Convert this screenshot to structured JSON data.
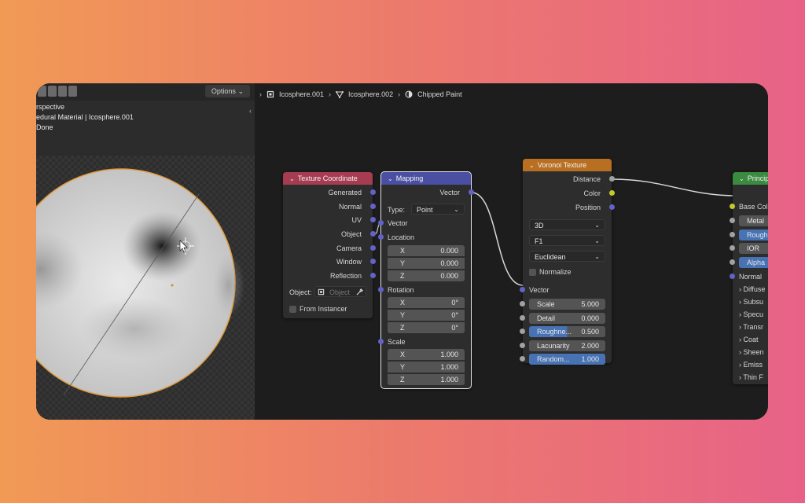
{
  "colors": {
    "texture_coordinate_header": "#a63c52",
    "mapping_header": "#4a4fa3",
    "voronoi_header": "#b86f22",
    "principled_header": "#3a8a3f",
    "vector_socket": "#6363c7",
    "float_socket": "#a1a1a1",
    "color_socket": "#c7c729",
    "active_field": "#4772b3"
  },
  "viewport": {
    "options_label": "Options",
    "line1": "rspective",
    "line2": "edural Material | Icosphere.001",
    "line3": "Done"
  },
  "breadcrumb": [
    {
      "label": "Icosphere.001",
      "icon": "object-icon"
    },
    {
      "label": "Icosphere.002",
      "icon": "mesh-icon"
    },
    {
      "label": "Chipped Paint",
      "icon": "material-icon"
    }
  ],
  "texture_coordinate": {
    "title": "Texture Coordinate",
    "outputs": [
      "Generated",
      "Normal",
      "UV",
      "Object",
      "Camera",
      "Window",
      "Reflection"
    ],
    "object_label": "Object:",
    "object_placeholder": "Object",
    "from_instancer": "From Instancer"
  },
  "mapping": {
    "title": "Mapping",
    "output": "Vector",
    "type_label": "Type:",
    "type_value": "Point",
    "vector_label": "Vector",
    "location_label": "Location",
    "location": [
      {
        "axis": "X",
        "value": "0.000"
      },
      {
        "axis": "Y",
        "value": "0.000"
      },
      {
        "axis": "Z",
        "value": "0.000"
      }
    ],
    "rotation_label": "Rotation",
    "rotation": [
      {
        "axis": "X",
        "value": "0°"
      },
      {
        "axis": "Y",
        "value": "0°"
      },
      {
        "axis": "Z",
        "value": "0°"
      }
    ],
    "scale_label": "Scale",
    "scale": [
      {
        "axis": "X",
        "value": "1.000"
      },
      {
        "axis": "Y",
        "value": "1.000"
      },
      {
        "axis": "Z",
        "value": "1.000"
      }
    ]
  },
  "voronoi": {
    "title": "Voronoi Texture",
    "outputs": [
      "Distance",
      "Color",
      "Position"
    ],
    "dimensions": "3D",
    "feature": "F1",
    "metric": "Euclidean",
    "normalize": "Normalize",
    "vector_label": "Vector",
    "params": [
      {
        "label": "Scale",
        "value": "5.000",
        "active": false
      },
      {
        "label": "Detail",
        "value": "0.000",
        "active": false
      },
      {
        "label": "Roughne...",
        "value": "0.500",
        "active": true,
        "fill": 0.5
      },
      {
        "label": "Lacunarity",
        "value": "2.000",
        "active": false
      },
      {
        "label": "Random...",
        "value": "1.000",
        "active": true,
        "fill": 1.0
      }
    ]
  },
  "principled": {
    "title": "Princip",
    "base_color": "Base Col",
    "fields": [
      "Metal",
      "Rough",
      "IOR",
      "Alpha"
    ],
    "normal": "Normal",
    "panels": [
      "Diffuse",
      "Subsu",
      "Specu",
      "Transr",
      "Coat",
      "Sheen",
      "Emiss",
      "Thin F"
    ]
  }
}
